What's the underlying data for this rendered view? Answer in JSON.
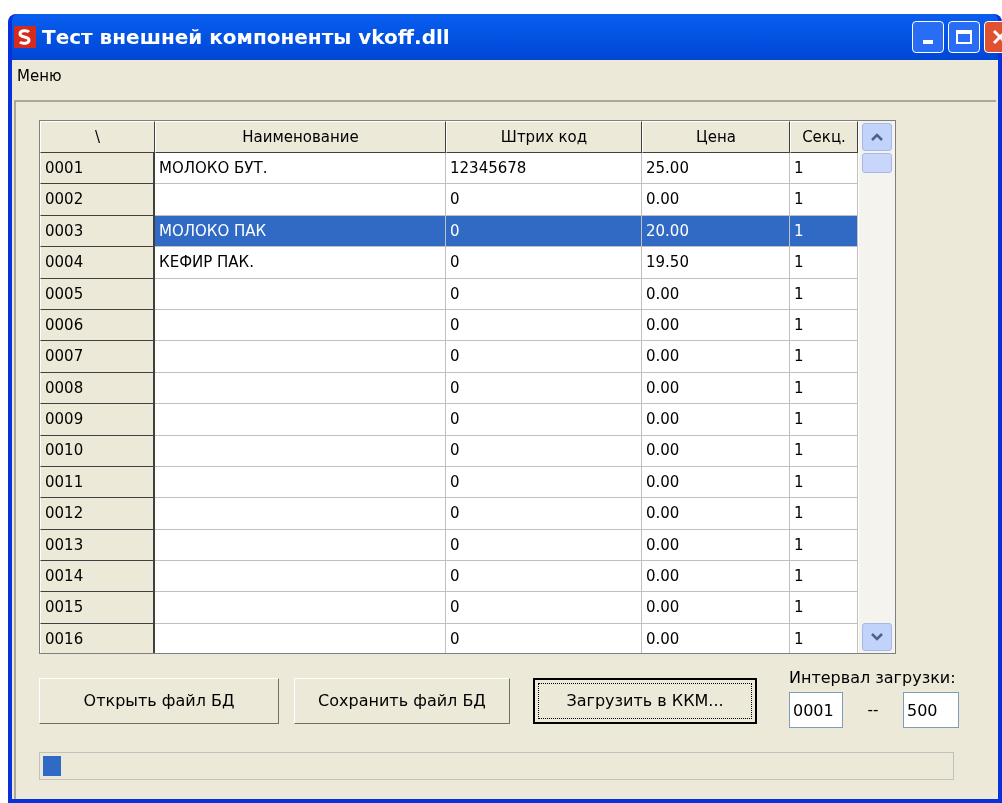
{
  "window": {
    "title": "Тест внешней компоненты vkoff.dll"
  },
  "menu": [
    "Меню"
  ],
  "table": {
    "columns": [
      "\\",
      "Наименование",
      "Штрих код",
      "Цена",
      "Секц."
    ],
    "rows": [
      {
        "number": "0001",
        "name": "МОЛОКО БУТ.",
        "barcode": "12345678",
        "price": "25.00",
        "section": "1",
        "selected": false
      },
      {
        "number": "0002",
        "name": "",
        "barcode": "0",
        "price": "0.00",
        "section": "1",
        "selected": false
      },
      {
        "number": "0003",
        "name": "МОЛОКО ПАК",
        "barcode": "0",
        "price": "20.00",
        "section": "1",
        "selected": true
      },
      {
        "number": "0004",
        "name": "КЕФИР ПАК.",
        "barcode": "0",
        "price": "19.50",
        "section": "1",
        "selected": false
      },
      {
        "number": "0005",
        "name": "",
        "barcode": "0",
        "price": "0.00",
        "section": "1",
        "selected": false
      },
      {
        "number": "0006",
        "name": "",
        "barcode": "0",
        "price": "0.00",
        "section": "1",
        "selected": false
      },
      {
        "number": "0007",
        "name": "",
        "barcode": "0",
        "price": "0.00",
        "section": "1",
        "selected": false
      },
      {
        "number": "0008",
        "name": "",
        "barcode": "0",
        "price": "0.00",
        "section": "1",
        "selected": false
      },
      {
        "number": "0009",
        "name": "",
        "barcode": "0",
        "price": "0.00",
        "section": "1",
        "selected": false
      },
      {
        "number": "0010",
        "name": "",
        "barcode": "0",
        "price": "0.00",
        "section": "1",
        "selected": false
      },
      {
        "number": "0011",
        "name": "",
        "barcode": "0",
        "price": "0.00",
        "section": "1",
        "selected": false
      },
      {
        "number": "0012",
        "name": "",
        "barcode": "0",
        "price": "0.00",
        "section": "1",
        "selected": false
      },
      {
        "number": "0013",
        "name": "",
        "barcode": "0",
        "price": "0.00",
        "section": "1",
        "selected": false
      },
      {
        "number": "0014",
        "name": "",
        "barcode": "0",
        "price": "0.00",
        "section": "1",
        "selected": false
      },
      {
        "number": "0015",
        "name": "",
        "barcode": "0",
        "price": "0.00",
        "section": "1",
        "selected": false
      },
      {
        "number": "0016",
        "name": "",
        "barcode": "0",
        "price": "0.00",
        "section": "1",
        "selected": false
      }
    ]
  },
  "buttons": [
    {
      "label": "Открыть файл БД",
      "focused": false
    },
    {
      "label": "Сохранить файл БД",
      "focused": false
    },
    {
      "label": "Загрузить в ККМ...",
      "focused": true
    }
  ],
  "interval": {
    "label": "Интервал загрузки:",
    "from": "0001",
    "separator": "--",
    "to": "500"
  },
  "progress": {
    "level": 0.02
  }
}
